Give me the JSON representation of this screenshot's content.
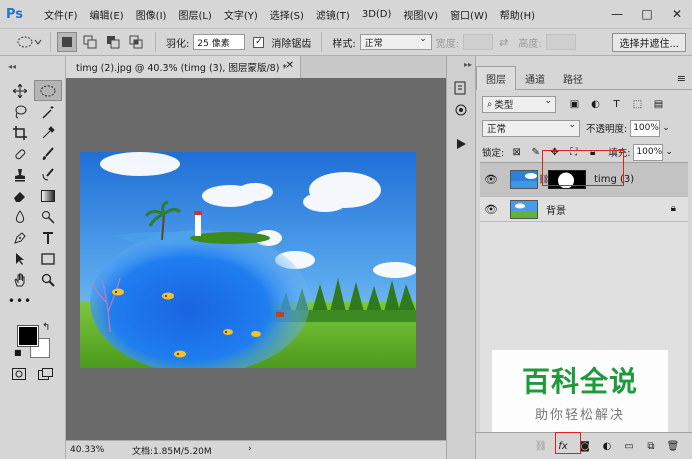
{
  "app": {
    "logo": "Ps"
  },
  "menu": [
    "文件(F)",
    "编辑(E)",
    "图像(I)",
    "图层(L)",
    "文字(Y)",
    "选择(S)",
    "滤镜(T)",
    "3D(D)",
    "视图(V)",
    "窗口(W)",
    "帮助(H)"
  ],
  "options": {
    "feather_label": "羽化:",
    "feather_value": "25 像素",
    "antialias_label": "消除锯齿",
    "antialias_checked": true,
    "style_label": "样式:",
    "style_value": "正常",
    "width_label": "宽度:",
    "height_label": "高度:",
    "refine_label": "选择并遮住..."
  },
  "document": {
    "tab_title": "timg (2).jpg @ 40.3% (timg (3), 图层蒙版/8) *",
    "zoom": "40.33%",
    "doc_info": "文档:1.85M/5.20M"
  },
  "layers_panel": {
    "tabs": [
      "图层",
      "通道",
      "路径"
    ],
    "active_tab": "图层",
    "kind_filter": "类型",
    "blend_mode": "正常",
    "opacity_label": "不透明度:",
    "opacity_value": "100%",
    "lock_label": "锁定:",
    "fill_label": "填充:",
    "fill_value": "100%",
    "layers": [
      {
        "name": "timg (3)",
        "selected": true,
        "has_mask": true
      },
      {
        "name": "背景",
        "selected": false,
        "locked": true
      }
    ]
  },
  "watermark": {
    "main": "百科全说",
    "sub": "助你轻松解决"
  },
  "colors": {
    "accent_red": "#e02020",
    "watermark_green": "#1e9a3c",
    "ps_blue": "#2b75c8"
  }
}
